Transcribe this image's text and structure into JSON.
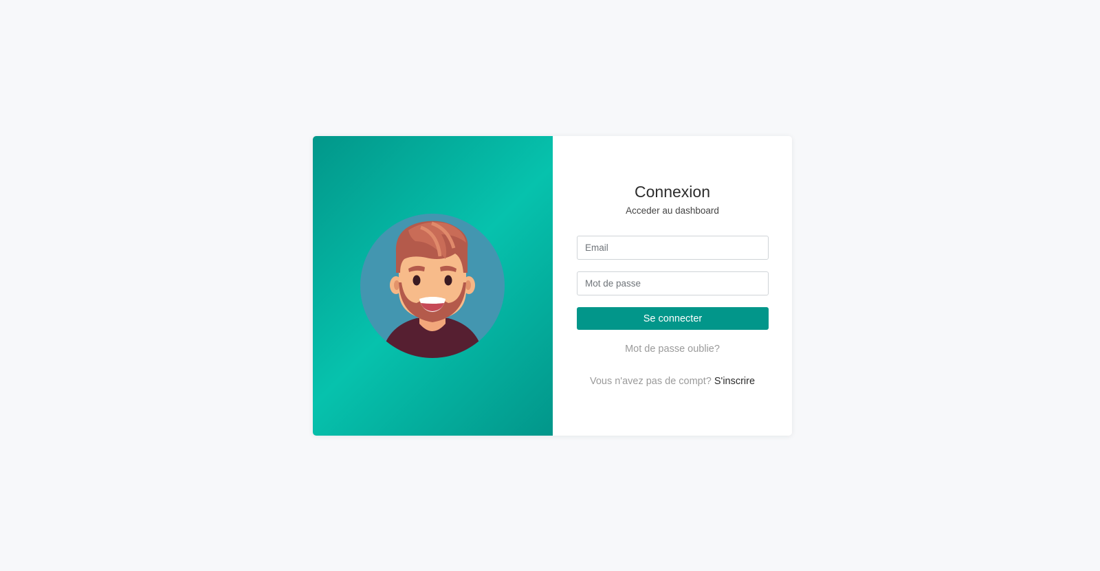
{
  "login": {
    "title": "Connexion",
    "subtitle": "Acceder au dashboard",
    "email_placeholder": "Email",
    "password_placeholder": "Mot de passe",
    "submit_label": "Se connecter",
    "forgot_password": "Mot de passe oublie?",
    "no_account_text": "Vous n'avez pas de compt?",
    "signup_label": "S'inscrire"
  },
  "illustration": {
    "icon": "user-avatar-illustration",
    "background_color": "#4396b0"
  },
  "colors": {
    "accent": "#02968a",
    "accent_light": "#06c2ad",
    "page_background": "#f7f8fa"
  }
}
